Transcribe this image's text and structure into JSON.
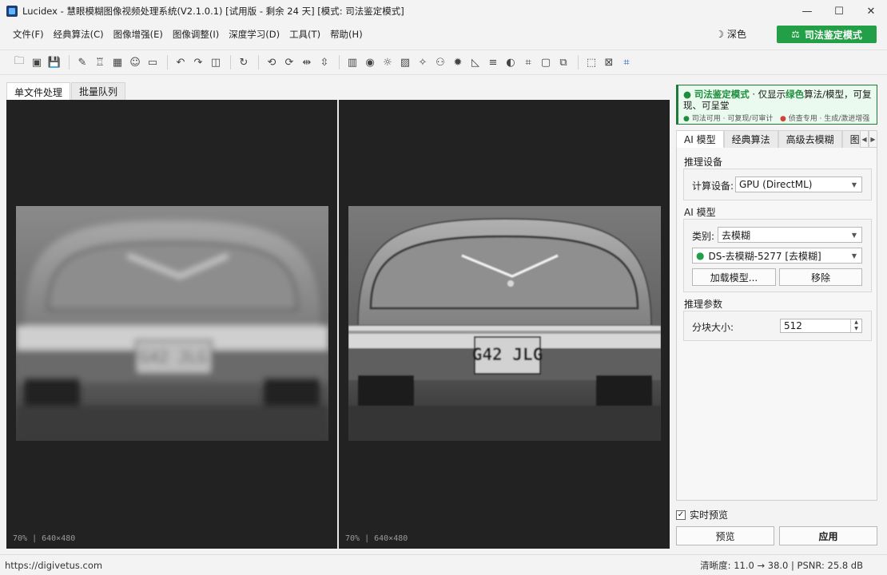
{
  "window": {
    "title": "Lucidex - 慧眼模糊图像视频处理系统(V2.1.0.1)  [试用版 - 剩余 24 天]  [模式: 司法鉴定模式]",
    "min": "—",
    "max": "☐",
    "close": "✕"
  },
  "menu": [
    "文件(F)",
    "经典算法(C)",
    "图像增强(E)",
    "图像调整(I)",
    "深度学习(D)",
    "工具(T)",
    "帮助(H)"
  ],
  "theme_toggle": {
    "icon": "moon-icon",
    "label": "深色"
  },
  "forensic_button": {
    "label": "司法鉴定模式",
    "icon": "scales-icon",
    "color": "#23a047"
  },
  "left_tabs": [
    "单文件处理",
    "批量队列"
  ],
  "viewers": {
    "left": {
      "info": "70% | 640×480"
    },
    "right": {
      "info": "70% | 640×480"
    }
  },
  "banner": {
    "mode": "司法鉴定模式",
    "sep": " · ",
    "desc_pre": "仅显示",
    "desc_green": "绿色",
    "desc_post": "算法/模型，可复现、可呈堂",
    "legend_green": "司法可用 · 可复现/可审计",
    "legend_red": "侦查专用 · 生成/激进增强"
  },
  "right_tabs": [
    "AI 模型",
    "经典算法",
    "高级去模糊",
    "图像"
  ],
  "sections": {
    "device": {
      "title": "推理设备",
      "label": "计算设备:",
      "value": "GPU (DirectML)"
    },
    "model": {
      "title": "AI 模型",
      "category_label": "类别:",
      "category_value": "去模糊",
      "model_value": "DS-去模糊-5277 [去模糊]",
      "load_button": "加载模型...",
      "remove_button": "移除"
    },
    "params": {
      "title": "推理参数",
      "tile_label": "分块大小:",
      "tile_value": "512"
    }
  },
  "realtime_preview": {
    "label": "实时预览",
    "checked": true
  },
  "buttons": {
    "preview": "预览",
    "apply": "应用"
  },
  "status": {
    "url": "https://digivetus.com",
    "metrics": "清晰度: 11.0 → 38.0  |  PSNR: 25.8 dB"
  }
}
